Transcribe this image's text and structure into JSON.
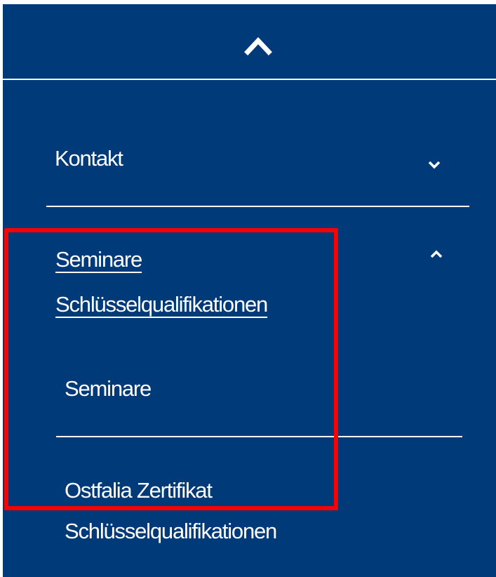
{
  "menu": {
    "collapse_icon": "chevron-up-icon",
    "items": [
      {
        "label": "Kontakt",
        "icon": "chevron-down-icon",
        "expanded": false
      },
      {
        "label": "Seminare\nSchlüsselqualifikationen",
        "icon": "chevron-up-icon",
        "expanded": true,
        "active": true,
        "children": [
          {
            "label": "Seminare"
          },
          {
            "label": "Ostfalia Zertifikat\nSchlüsselqualifikationen"
          }
        ]
      }
    ]
  },
  "colors": {
    "panel_background": "#003a78",
    "text": "#ffffff",
    "highlight_border": "#ff0000"
  }
}
